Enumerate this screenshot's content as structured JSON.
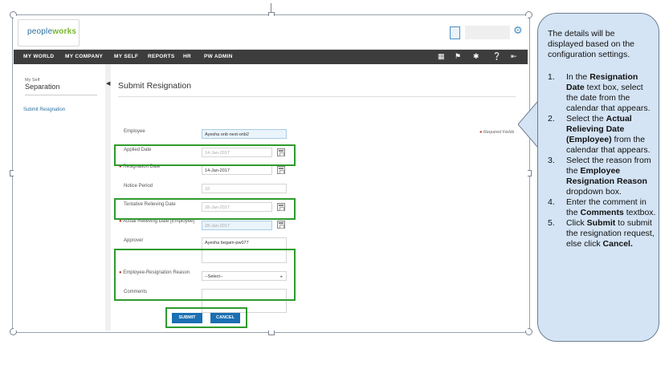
{
  "app": {
    "logo": {
      "prefix": "people",
      "suffix": "works"
    }
  },
  "navbar": {
    "items": [
      "MY WORLD",
      "MY COMPANY",
      "MY SELF",
      "REPORTS",
      "HR",
      "PW ADMIN"
    ]
  },
  "sidebar": {
    "breadcrumb": "My Self",
    "title": "Separation",
    "link": "Submit Resignation"
  },
  "form": {
    "title": "Submit Resignation",
    "required_note": "Required Fields",
    "fields": {
      "employee": {
        "label": "Employee",
        "value": "Ayesha onb next-onb2"
      },
      "applied_date": {
        "label": "Applied Date",
        "value": "14-Jan-2017"
      },
      "resignation_date": {
        "label": "Resignation Date",
        "value": "14-Jan-2017"
      },
      "notice_period": {
        "label": "Notice Period",
        "value": "10"
      },
      "tentative_relieving_date": {
        "label": "Tentative Relieving Date",
        "value": "28-Jan-2017"
      },
      "actual_relieving_date": {
        "label": "Actual Relieving Date [Employee]",
        "value": "28-Jan-2017"
      },
      "approver": {
        "label": "Approver",
        "value": "Ayesha begam-pw077"
      },
      "reason": {
        "label": "Employee-Resignation Reason",
        "value": "--Select--"
      },
      "comments": {
        "label": "Comments",
        "value": ""
      }
    },
    "buttons": {
      "submit": "SUBMIT",
      "cancel": "CANCEL"
    }
  },
  "callout": {
    "intro": "The details will be displayed based on the configuration settings.",
    "steps": [
      {
        "num": "1.",
        "parts": [
          {
            "t": "In the "
          },
          {
            "t": "Resignation Date",
            "b": true
          },
          {
            "t": " text box, select the date from the calendar that appears."
          }
        ]
      },
      {
        "num": "2.",
        "parts": [
          {
            "t": "Select the "
          },
          {
            "t": "Actual Relieving Date (Employee)",
            "b": true
          },
          {
            "t": " from the calendar that appears."
          }
        ]
      },
      {
        "num": "3.",
        "parts": [
          {
            "t": "Select the reason from the "
          },
          {
            "t": "Employee Resignation Reason",
            "b": true
          },
          {
            "t": " dropdown box."
          }
        ]
      },
      {
        "num": "4.",
        "parts": [
          {
            "t": "Enter the comment in the "
          },
          {
            "t": "Comments",
            "b": true
          },
          {
            "t": " textbox."
          }
        ]
      },
      {
        "num": "5.",
        "parts": [
          {
            "t": "Click "
          },
          {
            "t": "Submit",
            "b": true
          },
          {
            "t": " to submit the resignation request, else click "
          },
          {
            "t": "Cancel.",
            "b": true
          }
        ]
      }
    ]
  },
  "colors": {
    "highlight_box": "#2e9b2e",
    "nav_bg": "#3d3d3d",
    "button": "#1b6fb3",
    "callout_bg": "#d4e4f4",
    "required_star": "#c0392b"
  }
}
